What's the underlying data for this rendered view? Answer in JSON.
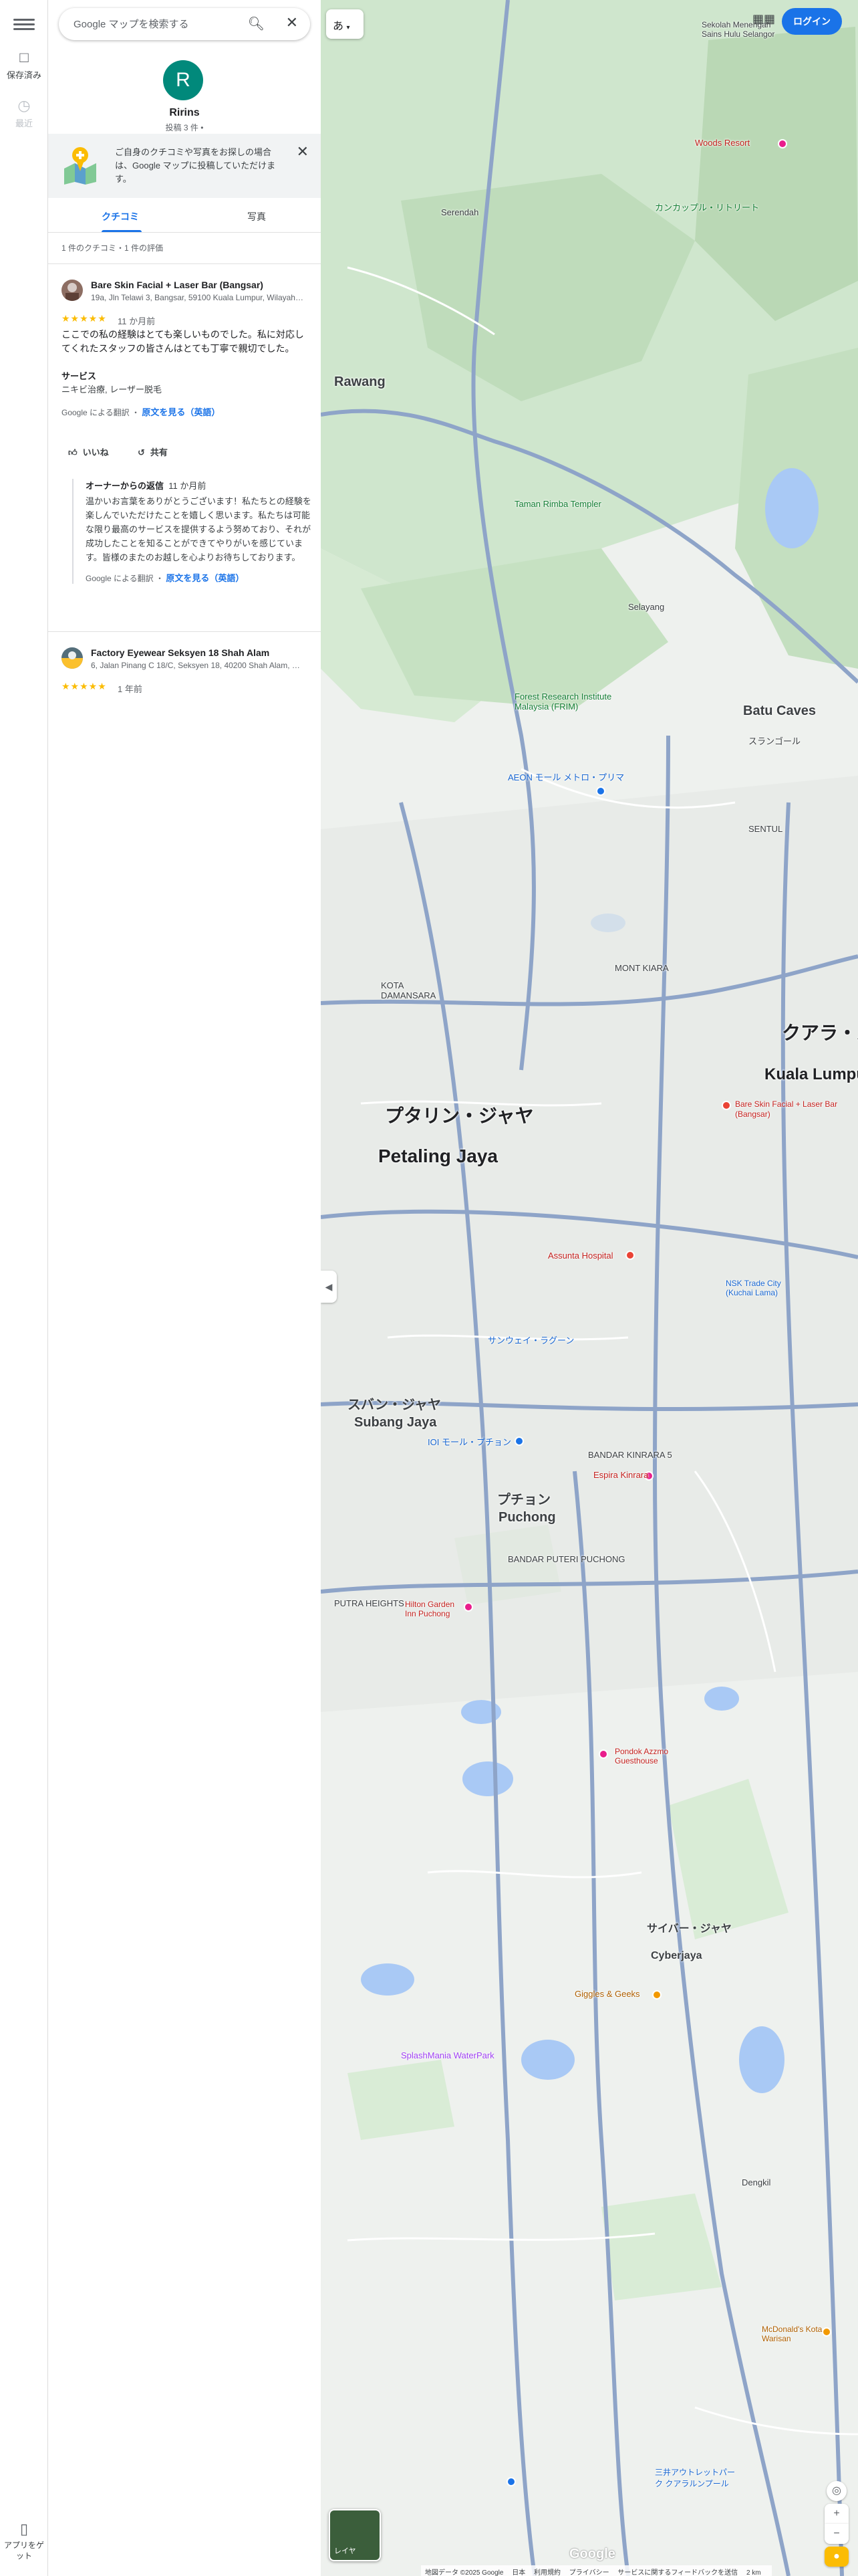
{
  "rail": {
    "saved_label": "保存済み",
    "recent_label": "最近",
    "app_label": "アプリをゲット"
  },
  "search": {
    "placeholder": "Google マップを検索する"
  },
  "profile": {
    "initial": "R",
    "name": "Ririns",
    "posts": "投稿 3 件 •"
  },
  "promo": {
    "text": "ご自身のクチコミや写真をお探しの場合は、Google マップに投稿していただけます。"
  },
  "tabs": [
    {
      "label": "クチコミ",
      "active": true
    },
    {
      "label": "写真",
      "active": false
    }
  ],
  "summary": "1 件のクチコミ・1 件の評価",
  "reviews": [
    {
      "place": "Bare Skin Facial + Laser Bar (Bangsar)",
      "address": "19a, Jln Telawi 3, Bangsar, 59100 Kuala Lumpur, Wilayah Persekutuan Kuala Lumpur",
      "stars": "★★★★★",
      "when": "11 か月前",
      "text": "ここでの私の経験はとても楽しいものでした。私に対応してくれたスタッフの皆さんはとても丁寧で親切でした。",
      "service_heading": "サービス",
      "service_value": "ニキビ治療, レーザー脱毛",
      "translated_by": "Google による翻訳 ・",
      "original_link": "原文を見る（英語）",
      "like_label": "いいね",
      "share_label": "共有",
      "owner_reply": {
        "heading": "オーナーからの返信",
        "when": "11 か月前",
        "text": "温かいお言葉をありがとうございます！私たちとの経験を楽しんでいただけたことを嬉しく思います。私たちは可能な限り最高のサービスを提供するよう努めており、それが成功したことを知ることができてやりがいを感じています。皆様のまたのお越しを心よりお待ちしております。",
        "translated_by": "Google による翻訳 ・",
        "original_link": "原文を見る（英語）"
      }
    },
    {
      "place": "Factory Eyewear Seksyen 18 Shah Alam",
      "address": "6, Jalan Pinang C 18/C, Seksyen 18, 40200 Shah Alam, Selangor",
      "stars": "★★★★★",
      "when": "1 年前"
    }
  ],
  "map": {
    "lang_button": "あ",
    "login_label": "ログイン",
    "layers_label": "レイヤ",
    "logo": "Google",
    "footer": [
      "地図データ ©2025 Google",
      "日本",
      "利用規約",
      "プライバシー",
      "サービスに関するフィードバックを送信",
      "2 km"
    ],
    "labels": {
      "rawang": "Rawang",
      "serendah": "Serendah",
      "batu_caves": "Batu Caves",
      "batu_caves_jp": "スランゴール",
      "kl_jp": "クアラ・ルンプル",
      "kl": "Kuala Lumpur",
      "pj_jp": "プタリン・ジャヤ",
      "pj": "Petaling Jaya",
      "subang_jp": "スバン・ジャヤ",
      "subang": "Subang Jaya",
      "puchong_jp": "プチョン",
      "puchong": "Puchong",
      "cyberjaya_jp": "サイバー・ジャヤ",
      "cyberjaya": "Cyberjaya",
      "selayang": "Selayang",
      "sentul": "SENTUL",
      "kota_damansara": "KOTA DAMANSARA",
      "mont_kiara": "MONT KIARA",
      "bandar_kinrara": "BANDAR KINRARA 5",
      "bandar_puteri": "BANDAR PUTERI PUCHONG",
      "putra_heights": "PUTRA HEIGHTS",
      "dengkil": "Dengkil",
      "frim": "Forest Research Institute Malaysia (FRIM)",
      "bare_skin": "Bare Skin Facial + Laser Bar (Bangsar)",
      "assunta": "Assunta Hospital",
      "aeon_metro": "AEON モール メトロ・プリマ",
      "ioi": "IOI モール・プチョン",
      "sunway": "サンウェイ・ラグーン",
      "hilton": "Hilton Garden Inn Puchong",
      "splashmania": "SplashMania WaterPark",
      "mitsui": "三井アウトレットパーク クアラルンプール",
      "woods": "Woods Resort",
      "sekolah": "Sekolah Menengah Sains Hulu Selangor",
      "kankapur": "カンカップル・リトリート",
      "tuan_ismail": "Taman Rimba Templer",
      "nsk": "NSK Trade City (Kuchai Lama)",
      "espira": "Espira Kinrara",
      "pondok": "Pondok Azzmo Guesthouse",
      "giggles": "Giggles & Geeks",
      "mcdonalds": "McDonald's Kota Warisan"
    }
  }
}
